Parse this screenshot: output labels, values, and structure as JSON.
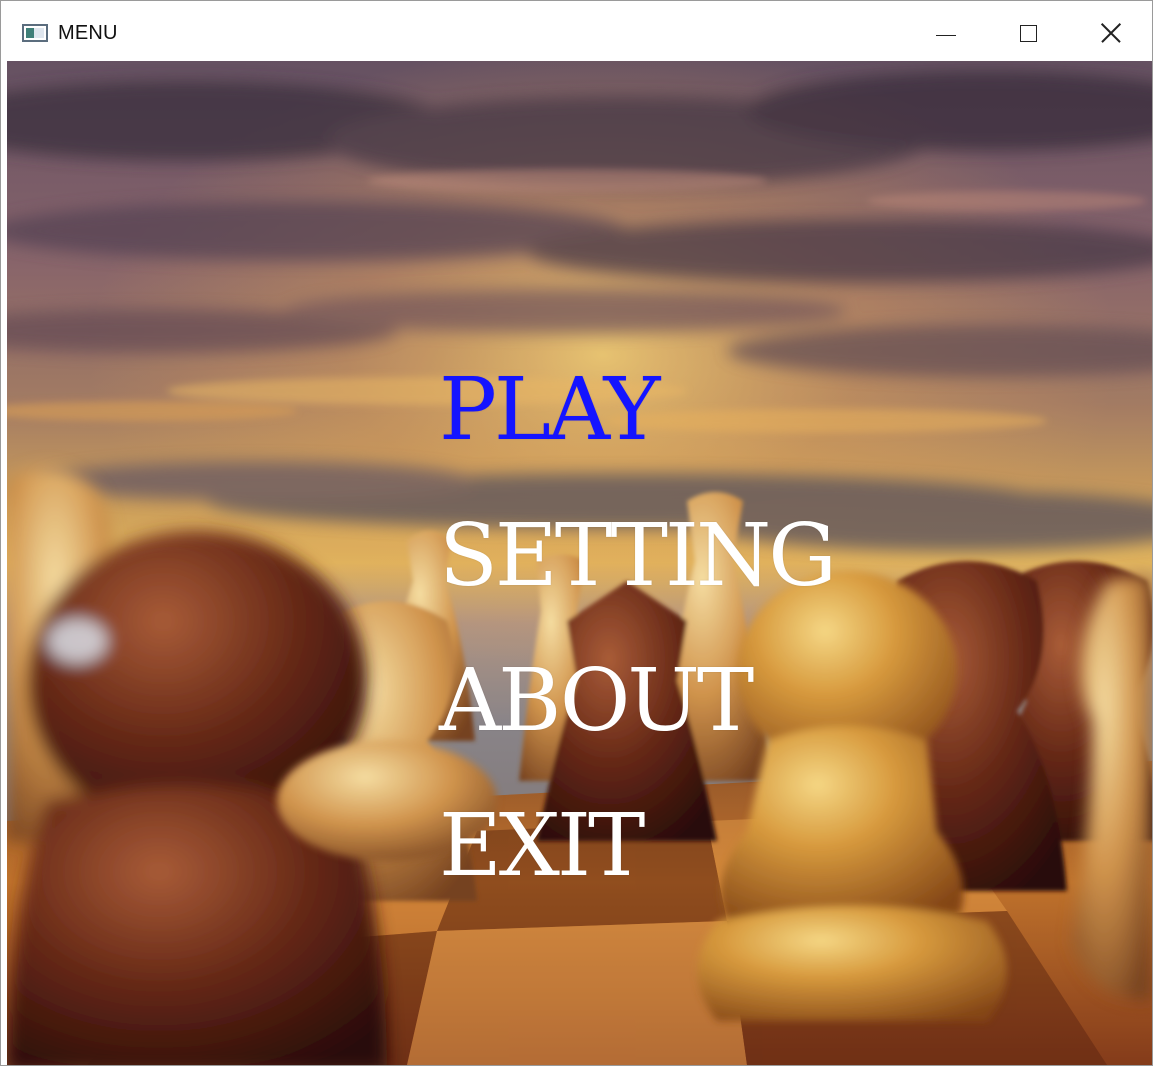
{
  "window": {
    "title": "MENU",
    "icon": "app-window-icon",
    "controls": {
      "minimize_icon": "minimize-icon",
      "maximize_icon": "maximize-icon",
      "close_icon": "close-icon"
    }
  },
  "scene": {
    "background_icon": "chess-sunset-background"
  },
  "menu": {
    "items": [
      {
        "label": "PLAY",
        "color": "#1414ff",
        "selected": true
      },
      {
        "label": "SETTING",
        "color": "#ffffff",
        "selected": false
      },
      {
        "label": "ABOUT",
        "color": "#ffffff",
        "selected": false
      },
      {
        "label": "EXIT",
        "color": "#ffffff",
        "selected": false
      }
    ]
  }
}
